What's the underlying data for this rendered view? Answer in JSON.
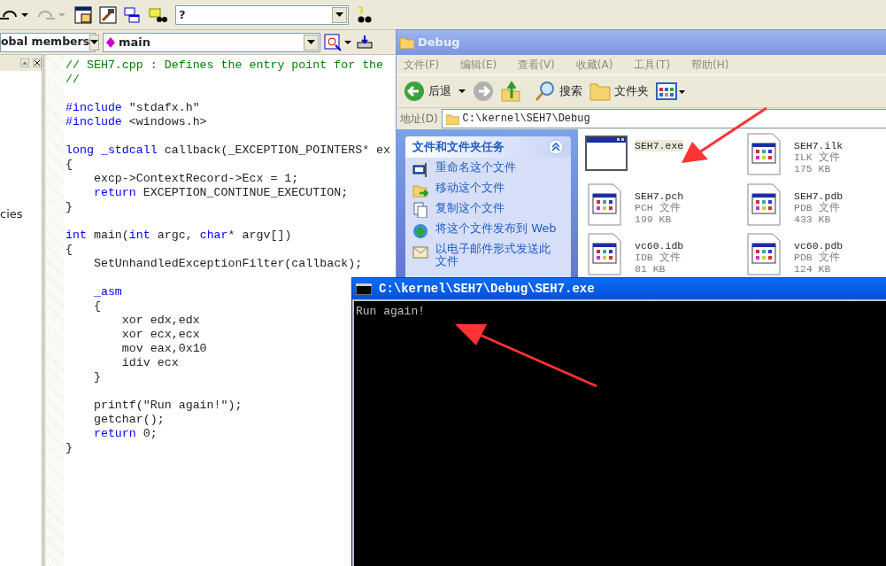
{
  "ide": {
    "toolbar": {
      "find_combo": {
        "value": "?"
      }
    },
    "wizard_bar": {
      "scope_combo": {
        "value": "obal members"
      },
      "member_combo": {
        "value": "main"
      }
    },
    "workspace": {
      "items": [
        {
          "label": "cies"
        }
      ]
    },
    "editor": {
      "lines": [
        {
          "tokens": [
            {
              "text": "// SEH7.cpp : Defines the entry point for the",
              "kind": "comment"
            }
          ]
        },
        {
          "tokens": [
            {
              "text": "//",
              "kind": "comment"
            }
          ]
        },
        {
          "kind": "blank"
        },
        {
          "tokens": [
            {
              "text": "#include",
              "kind": "keyword"
            },
            {
              "text": " \"stdafx.h\"",
              "kind": "plain"
            }
          ]
        },
        {
          "tokens": [
            {
              "text": "#include",
              "kind": "keyword"
            },
            {
              "text": " <windows.h>",
              "kind": "plain"
            }
          ]
        },
        {
          "kind": "blank"
        },
        {
          "tokens": [
            {
              "text": "long _stdcall",
              "kind": "keyword"
            },
            {
              "text": " callback(_EXCEPTION_POINTERS* ex",
              "kind": "plain"
            }
          ]
        },
        {
          "tokens": [
            {
              "text": "{",
              "kind": "plain"
            }
          ]
        },
        {
          "tokens": [
            {
              "text": "    excp->ContextRecord->Ecx = 1;",
              "kind": "plain"
            }
          ]
        },
        {
          "tokens": [
            {
              "text": "    return",
              "kind": "keyword"
            },
            {
              "text": " EXCEPTION_CONTINUE_EXECUTION;",
              "kind": "plain"
            }
          ]
        },
        {
          "tokens": [
            {
              "text": "}",
              "kind": "plain"
            }
          ]
        },
        {
          "kind": "blank"
        },
        {
          "tokens": [
            {
              "text": "int",
              "kind": "keyword"
            },
            {
              "text": " main(",
              "kind": "plain"
            },
            {
              "text": "int",
              "kind": "keyword"
            },
            {
              "text": " argc, ",
              "kind": "plain"
            },
            {
              "text": "char",
              "kind": "keyword"
            },
            {
              "text": "* argv[])",
              "kind": "plain"
            }
          ]
        },
        {
          "tokens": [
            {
              "text": "{",
              "kind": "plain"
            }
          ]
        },
        {
          "tokens": [
            {
              "text": "    SetUnhandledExceptionFilter(callback);",
              "kind": "plain"
            }
          ]
        },
        {
          "kind": "blank"
        },
        {
          "tokens": [
            {
              "text": "    _asm",
              "kind": "keyword"
            }
          ]
        },
        {
          "tokens": [
            {
              "text": "    {",
              "kind": "plain"
            }
          ]
        },
        {
          "tokens": [
            {
              "text": "        xor edx,edx",
              "kind": "plain"
            }
          ]
        },
        {
          "tokens": [
            {
              "text": "        xor ecx,ecx",
              "kind": "plain"
            }
          ]
        },
        {
          "tokens": [
            {
              "text": "        mov eax,0x10",
              "kind": "plain"
            }
          ]
        },
        {
          "tokens": [
            {
              "text": "        idiv ecx",
              "kind": "plain"
            }
          ]
        },
        {
          "tokens": [
            {
              "text": "    }",
              "kind": "plain"
            }
          ]
        },
        {
          "kind": "blank"
        },
        {
          "tokens": [
            {
              "text": "    printf(\"Run again!\");",
              "kind": "plain"
            }
          ]
        },
        {
          "tokens": [
            {
              "text": "    getchar();",
              "kind": "plain"
            }
          ]
        },
        {
          "tokens": [
            {
              "text": "    return",
              "kind": "keyword"
            },
            {
              "text": " 0;",
              "kind": "plain"
            }
          ]
        },
        {
          "tokens": [
            {
              "text": "}",
              "kind": "plain"
            }
          ]
        }
      ]
    }
  },
  "explorer": {
    "title": "Debug",
    "menu": [
      "文件(F)",
      "编辑(E)",
      "查看(V)",
      "收藏(A)",
      "工具(T)",
      "帮助(H)"
    ],
    "toolbar": {
      "back": "后退",
      "search": "搜索",
      "folders": "文件夹"
    },
    "address": {
      "label": "地址(D)",
      "value": "C:\\kernel\\SEH7\\Debug"
    },
    "tasks": {
      "title": "文件和文件夹任务",
      "items": [
        {
          "label": "重命名这个文件",
          "kind": "rename"
        },
        {
          "label": "移动这个文件",
          "kind": "move"
        },
        {
          "label": "复制这个文件",
          "kind": "copy"
        },
        {
          "label": "将这个文件发布到 Web",
          "kind": "publish"
        },
        {
          "label": "以电子邮件形式发送此文件",
          "kind": "email"
        }
      ]
    },
    "files": [
      {
        "name": "SEH7.exe",
        "kind": "app",
        "selected": true
      },
      {
        "name": "SEH7.ilk",
        "type": "ILK 文件",
        "size": "175 KB",
        "kind": "doc",
        "selected": false
      },
      {
        "name": "SEH7.pch",
        "type": "PCH 文件",
        "size": "199 KB",
        "kind": "doc",
        "selected": false
      },
      {
        "name": "SEH7.pdb",
        "type": "PDB 文件",
        "size": "433 KB",
        "kind": "doc",
        "selected": false
      },
      {
        "name": "vc60.idb",
        "type": "IDB 文件",
        "size": "81 KB",
        "kind": "doc",
        "selected": false
      },
      {
        "name": "vc60.pdb",
        "type": "PDB 文件",
        "size": "124 KB",
        "kind": "doc",
        "selected": false
      }
    ]
  },
  "console": {
    "title": "C:\\kernel\\SEH7\\Debug\\SEH7.exe",
    "output": "Run again!"
  }
}
